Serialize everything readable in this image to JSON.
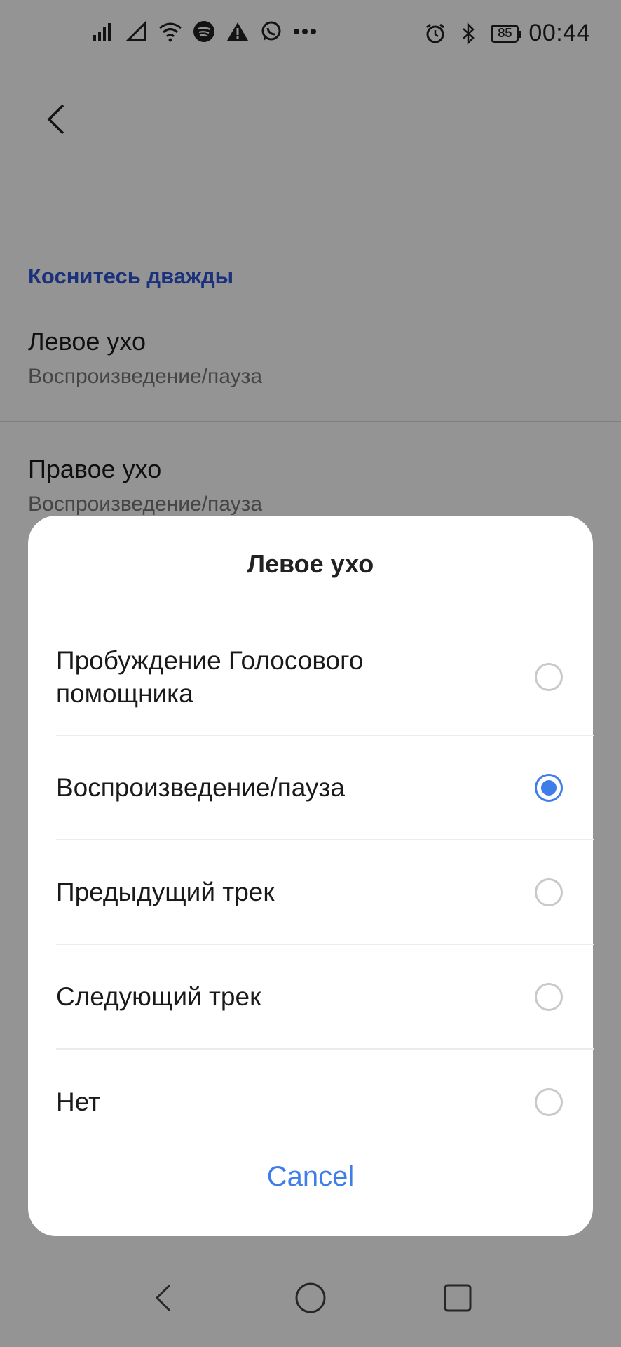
{
  "status_bar": {
    "time": "00:44",
    "battery_level": "85",
    "left_icons": [
      "signal-icon",
      "signal-empty-icon",
      "wifi-icon",
      "spotify-icon",
      "warning-icon",
      "whatsapp-icon",
      "more-dots-icon"
    ],
    "right_icons": [
      "alarm-icon",
      "bluetooth-icon",
      "battery-icon"
    ]
  },
  "screen": {
    "section_header": "Коснитесь дважды",
    "preferences": [
      {
        "title": "Левое ухо",
        "summary": "Воспроизведение/пауза"
      },
      {
        "title": "Правое ухо",
        "summary": "Воспроизведение/пауза"
      }
    ]
  },
  "dialog": {
    "title": "Левое ухо",
    "options": [
      {
        "label": "Пробуждение Голосового помощника",
        "checked": false
      },
      {
        "label": "Воспроизведение/пауза",
        "checked": true
      },
      {
        "label": "Предыдущий трек",
        "checked": false
      },
      {
        "label": "Следующий трек",
        "checked": false
      },
      {
        "label": "Нет",
        "checked": false
      }
    ],
    "cancel_label": "Cancel"
  },
  "colors": {
    "accent": "#3f7ee8",
    "section_header": "#2f55d4",
    "scrim": "rgba(0,0,0,0.42)"
  }
}
